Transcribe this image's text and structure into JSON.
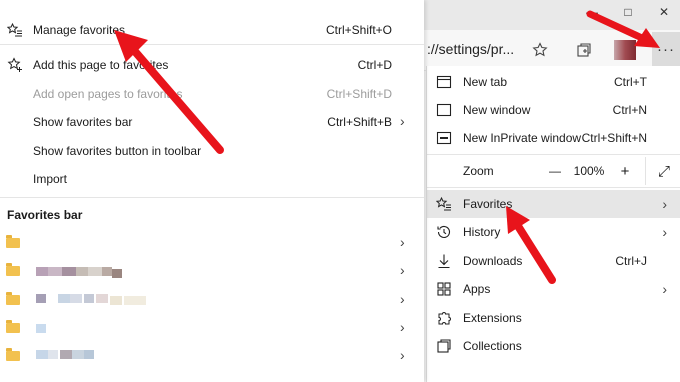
{
  "window": {
    "minimize_glyph": "—",
    "maximize_glyph": "□",
    "close_glyph": "✕"
  },
  "address_bar": {
    "url": "://settings/pr...",
    "star_icon": "star-icon",
    "collections_icon": "collections-icon",
    "more_glyph": "···"
  },
  "favorites_menu": {
    "items": [
      {
        "label": "Manage favorites",
        "shortcut": "Ctrl+Shift+O",
        "icon": "star-list-icon",
        "disabled": false
      },
      {
        "label": "Add this page to favorites",
        "shortcut": "Ctrl+D",
        "icon": "star-add-icon",
        "disabled": false
      },
      {
        "label": "Add open pages to favorites",
        "shortcut": "Ctrl+Shift+D",
        "icon": "",
        "disabled": true
      },
      {
        "label": "Show favorites bar",
        "shortcut": "Ctrl+Shift+B",
        "icon": "",
        "disabled": false,
        "chevron": "›"
      },
      {
        "label": "Show favorites button in toolbar",
        "shortcut": "",
        "icon": "",
        "disabled": false
      },
      {
        "label": "Import",
        "shortcut": "",
        "icon": "",
        "disabled": false
      }
    ],
    "favorites_bar_heading": "Favorites bar",
    "chevron": "›"
  },
  "main_menu": {
    "new_tab": {
      "label": "New tab",
      "shortcut": "Ctrl+T"
    },
    "new_window": {
      "label": "New window",
      "shortcut": "Ctrl+N"
    },
    "new_inprivate": {
      "label": "New InPrivate window",
      "shortcut": "Ctrl+Shift+N"
    },
    "zoom": {
      "label": "Zoom",
      "minus": "—",
      "value": "100%",
      "plus": "+",
      "fullscreen": "⤢"
    },
    "favorites": {
      "label": "Favorites",
      "chevron": "›"
    },
    "history": {
      "label": "History",
      "chevron": "›"
    },
    "downloads": {
      "label": "Downloads",
      "shortcut": "Ctrl+J"
    },
    "apps": {
      "label": "Apps",
      "chevron": "›"
    },
    "extensions": {
      "label": "Extensions"
    },
    "collections": {
      "label": "Collections"
    }
  },
  "colors": {
    "annotation_arrow": "#e8141b",
    "folder": "#f2c14f",
    "active_row": "#e6e6e6"
  }
}
